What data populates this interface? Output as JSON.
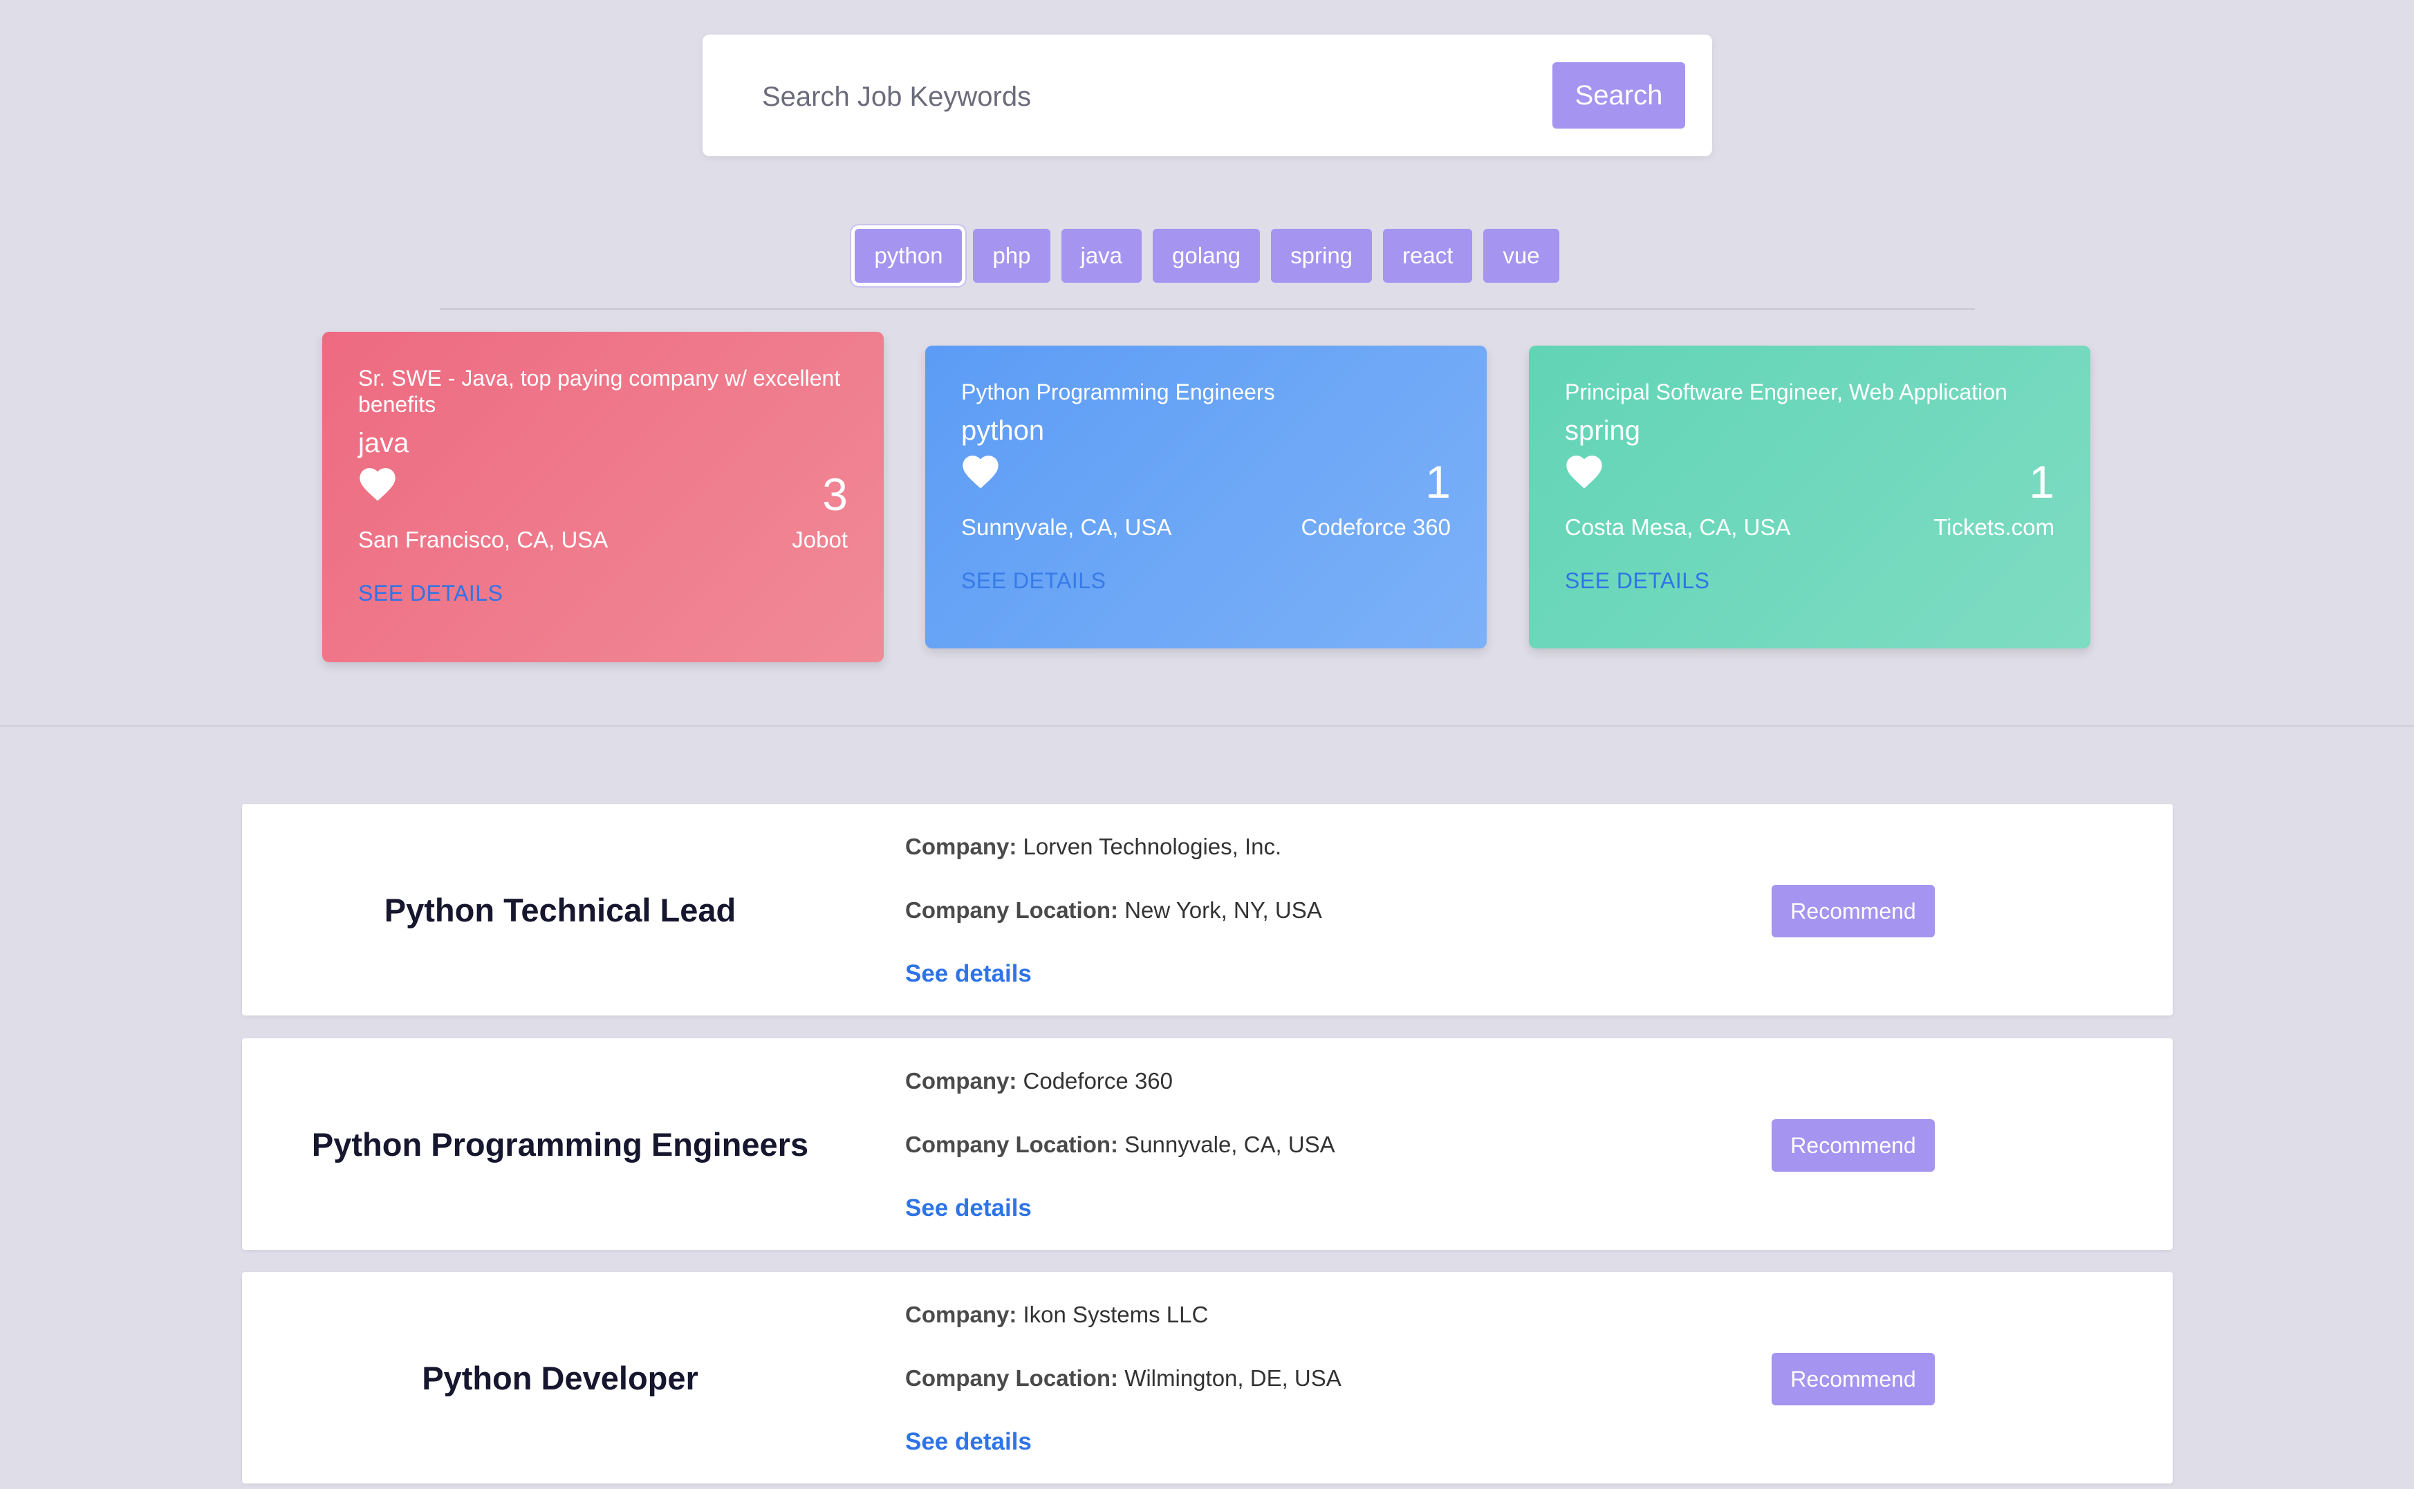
{
  "search": {
    "placeholder": "Search Job Keywords",
    "button_label": "Search"
  },
  "tags": [
    {
      "label": "python",
      "active": true
    },
    {
      "label": "php",
      "active": false
    },
    {
      "label": "java",
      "active": false
    },
    {
      "label": "golang",
      "active": false
    },
    {
      "label": "spring",
      "active": false
    },
    {
      "label": "react",
      "active": false
    },
    {
      "label": "vue",
      "active": false
    }
  ],
  "cards": [
    {
      "title": "Sr. SWE - Java, top paying company w/ excellent benefits",
      "tag": "java",
      "count": "3",
      "location": "San Francisco, CA, USA",
      "company": "Jobot",
      "link_label": "SEE DETAILS",
      "color": "#ee6a80"
    },
    {
      "title": "Python Programming Engineers",
      "tag": "python",
      "count": "1",
      "location": "Sunnyvale, CA, USA",
      "company": "Codeforce 360",
      "link_label": "SEE DETAILS",
      "color": "#5c9cf6"
    },
    {
      "title": "Principal Software Engineer, Web Application",
      "tag": "spring",
      "count": "1",
      "location": "Costa Mesa, CA, USA",
      "company": "Tickets.com",
      "link_label": "SEE DETAILS",
      "color": "#62d4b6"
    }
  ],
  "jobs": [
    {
      "title": "Python Technical Lead",
      "company_label": "Company:",
      "company": "Lorven Technologies, Inc.",
      "location_label": "Company Location:",
      "location": "New York, NY, USA",
      "details_label": "See details",
      "recommend_label": "Recommend"
    },
    {
      "title": "Python Programming Engineers",
      "company_label": "Company:",
      "company": "Codeforce 360",
      "location_label": "Company Location:",
      "location": "Sunnyvale, CA, USA",
      "details_label": "See details",
      "recommend_label": "Recommend"
    },
    {
      "title": "Python Developer",
      "company_label": "Company:",
      "company": "Ikon Systems LLC",
      "location_label": "Company Location:",
      "location": "Wilmington, DE, USA",
      "details_label": "See details",
      "recommend_label": "Recommend"
    }
  ],
  "colors": {
    "accent": "#a594f0",
    "link": "#2f74e6",
    "background": "#dfdde8"
  }
}
